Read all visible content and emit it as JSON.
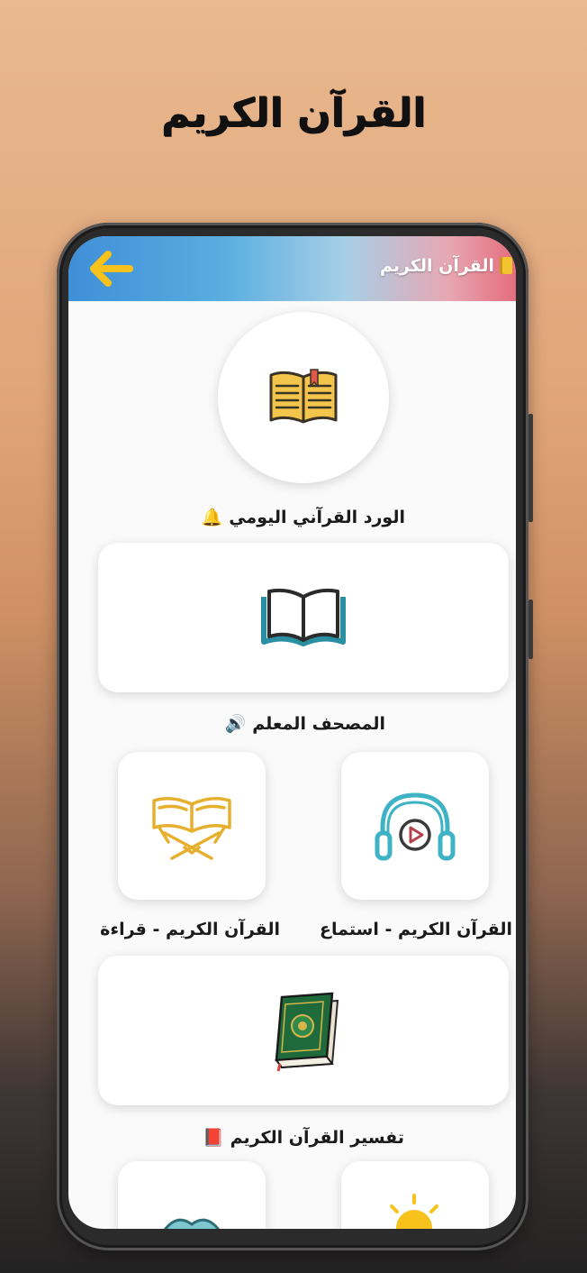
{
  "promo": {
    "title": "القرآن الكريم"
  },
  "header": {
    "title": "القرآن الكريم",
    "back_icon": "arrow-left-icon",
    "title_icon": "notebook-icon"
  },
  "items": [
    {
      "label": "الورد القرآني اليومي",
      "emoji": "🔔",
      "icon": "open-book-icon"
    },
    {
      "label": "المصحف المعلم",
      "emoji": "🔊",
      "icon": "open-book-outline-icon"
    },
    {
      "label": "القرآن الكريم - استماع",
      "icon": "headphones-play-icon"
    },
    {
      "label": "القرآن الكريم - قراءة",
      "icon": "quran-stand-icon"
    },
    {
      "label": "تفسير القرآن الكريم",
      "emoji": "📕",
      "icon": "mushaf-book-icon"
    }
  ],
  "colors": {
    "header_start": "#3f8fd8",
    "header_end": "#e46d7d",
    "accent_yellow": "#f4c430",
    "teal": "#3fb3c6"
  }
}
